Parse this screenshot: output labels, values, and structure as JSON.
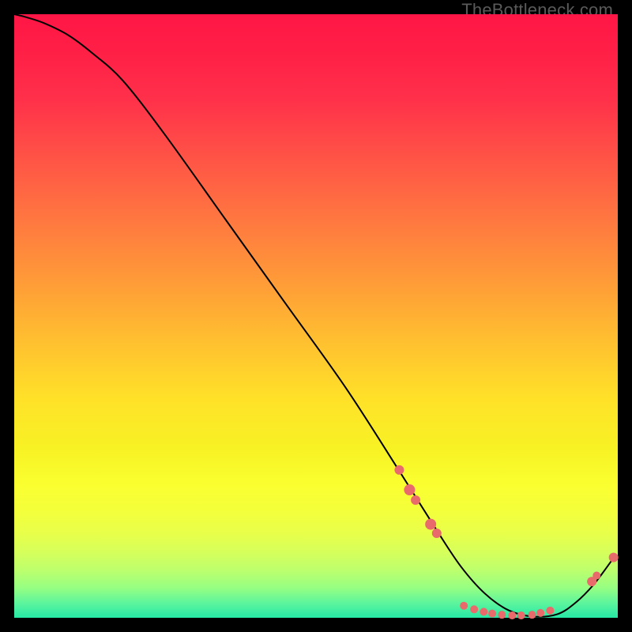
{
  "watermark": "TheBottleneck.com",
  "chart_data": {
    "type": "line",
    "title": "",
    "xlabel": "",
    "ylabel": "",
    "xlim": [
      0,
      1
    ],
    "ylim": [
      0,
      1
    ],
    "series": [
      {
        "name": "curve",
        "stroke": "#000000",
        "stroke_width": 2,
        "x": [
          0.0,
          0.02,
          0.05,
          0.09,
          0.13,
          0.18,
          0.25,
          0.35,
          0.45,
          0.55,
          0.64,
          0.7,
          0.74,
          0.78,
          0.82,
          0.86,
          0.9,
          0.93,
          0.96,
          0.99
        ],
        "y": [
          1.0,
          0.995,
          0.985,
          0.965,
          0.935,
          0.89,
          0.8,
          0.66,
          0.52,
          0.38,
          0.24,
          0.145,
          0.085,
          0.04,
          0.012,
          0.002,
          0.006,
          0.025,
          0.055,
          0.095
        ]
      }
    ],
    "markers": [
      {
        "x": 0.638,
        "y": 0.245,
        "r": 6,
        "fill": "#e96a6a"
      },
      {
        "x": 0.655,
        "y": 0.212,
        "r": 7,
        "fill": "#e96a6a"
      },
      {
        "x": 0.665,
        "y": 0.195,
        "r": 6,
        "fill": "#e96a6a"
      },
      {
        "x": 0.69,
        "y": 0.155,
        "r": 7,
        "fill": "#e96a6a"
      },
      {
        "x": 0.7,
        "y": 0.14,
        "r": 6,
        "fill": "#e96a6a"
      },
      {
        "x": 0.745,
        "y": 0.02,
        "r": 5,
        "fill": "#e96a6a"
      },
      {
        "x": 0.762,
        "y": 0.014,
        "r": 5,
        "fill": "#e96a6a"
      },
      {
        "x": 0.778,
        "y": 0.01,
        "r": 5,
        "fill": "#e96a6a"
      },
      {
        "x": 0.792,
        "y": 0.007,
        "r": 5,
        "fill": "#e96a6a"
      },
      {
        "x": 0.808,
        "y": 0.005,
        "r": 5,
        "fill": "#e96a6a"
      },
      {
        "x": 0.825,
        "y": 0.004,
        "r": 5,
        "fill": "#e96a6a"
      },
      {
        "x": 0.84,
        "y": 0.004,
        "r": 5,
        "fill": "#e96a6a"
      },
      {
        "x": 0.858,
        "y": 0.005,
        "r": 5,
        "fill": "#e96a6a"
      },
      {
        "x": 0.872,
        "y": 0.008,
        "r": 5,
        "fill": "#e96a6a"
      },
      {
        "x": 0.888,
        "y": 0.012,
        "r": 5,
        "fill": "#e96a6a"
      },
      {
        "x": 0.957,
        "y": 0.06,
        "r": 6,
        "fill": "#e96a6a"
      },
      {
        "x": 0.965,
        "y": 0.07,
        "r": 5,
        "fill": "#e96a6a"
      },
      {
        "x": 0.993,
        "y": 0.1,
        "r": 6,
        "fill": "#e96a6a"
      }
    ],
    "colors": {
      "marker": "#e96a6a",
      "curve": "#000000",
      "frame": "#000000"
    }
  }
}
